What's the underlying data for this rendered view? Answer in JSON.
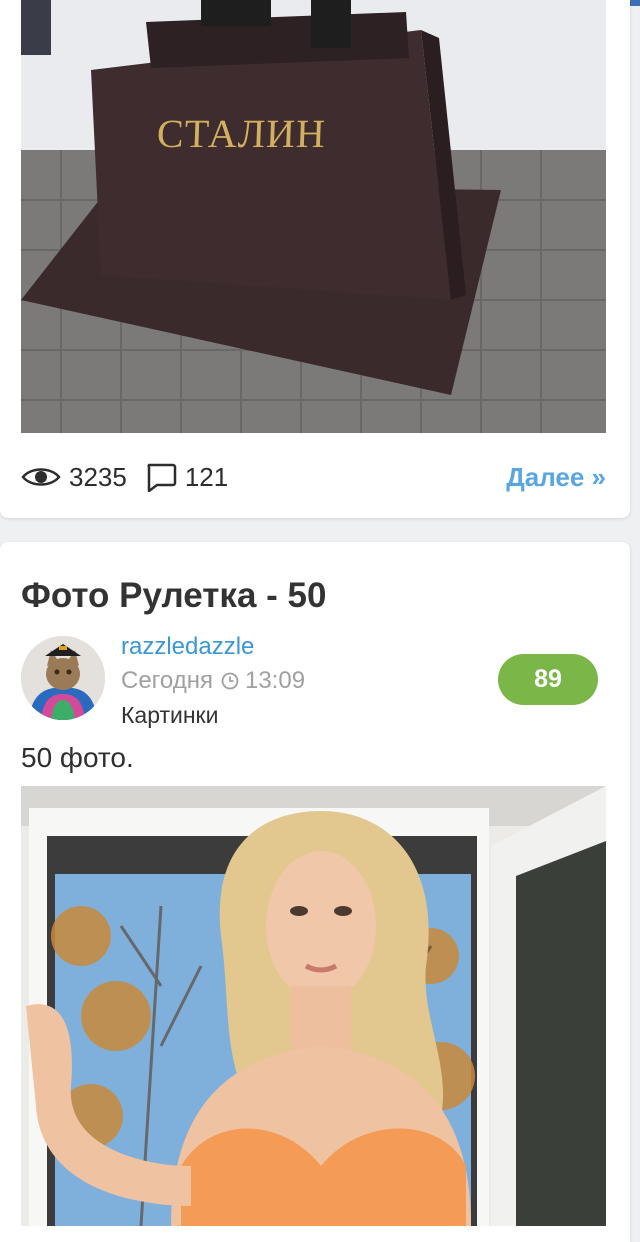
{
  "post1": {
    "statue_inscription": "СТАЛИН",
    "views": "3235",
    "comments": "121",
    "more_label": "Далее »"
  },
  "post2": {
    "title": "Фото Рулетка - 50",
    "author": "razzledazzle",
    "date": "Сегодня",
    "time": "13:09",
    "category": "Картинки",
    "rating": "89",
    "description": "50 фото."
  },
  "colors": {
    "accent_link": "#5aa6e0",
    "author_link": "#3a97d4",
    "badge_green": "#7ab648",
    "topbar_blue": "#3f6fb3"
  },
  "icons": [
    "eye-icon",
    "comment-icon",
    "clock-icon"
  ]
}
